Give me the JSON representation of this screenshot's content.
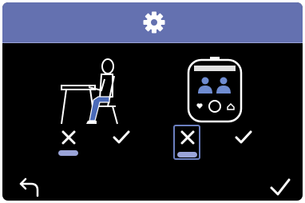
{
  "header": {
    "icon": "gear-icon",
    "background_color": "#6471b0"
  },
  "options": [
    {
      "id": "desk-posture",
      "illustration": "person-sitting-at-desk-icon",
      "choices": [
        {
          "icon": "cross-icon",
          "selected": true,
          "focused": false
        },
        {
          "icon": "check-icon",
          "selected": false,
          "focused": false
        }
      ]
    },
    {
      "id": "device-profiles",
      "illustration": "device-with-users-icon",
      "choices": [
        {
          "icon": "cross-icon",
          "selected": true,
          "focused": true
        },
        {
          "icon": "check-icon",
          "selected": false,
          "focused": false
        }
      ]
    }
  ],
  "footer": {
    "left_icon": "back-arrow-icon",
    "right_icon": "confirm-check-icon"
  },
  "colors": {
    "accent": "#6471b0",
    "selection_bar": "#9aa4d8",
    "focus_border": "#6b7fbf",
    "background": "#000000",
    "foreground": "#ffffff"
  }
}
